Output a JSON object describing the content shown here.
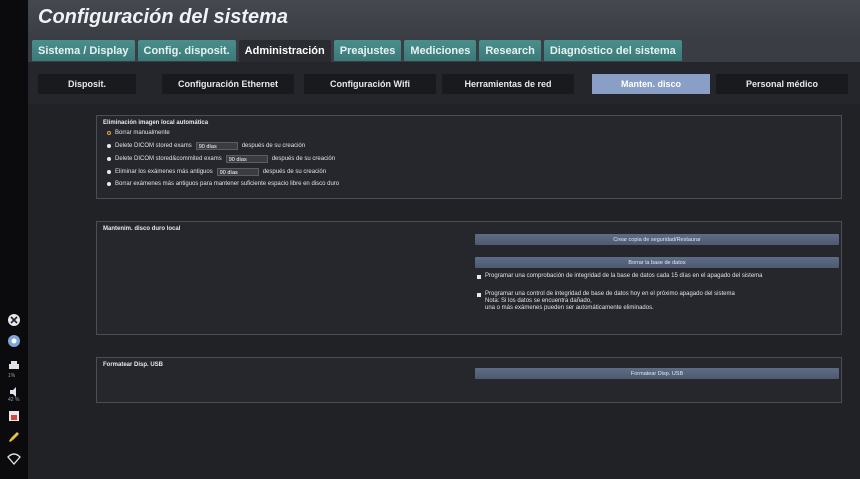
{
  "header": {
    "title": "Configuración del sistema"
  },
  "tabs": [
    {
      "label": "Sistema / Display",
      "active": false
    },
    {
      "label": "Config. disposit.",
      "active": false
    },
    {
      "label": "Administración",
      "active": true
    },
    {
      "label": "Preajustes",
      "active": false
    },
    {
      "label": "Mediciones",
      "active": false
    },
    {
      "label": "Research",
      "active": false
    },
    {
      "label": "Diagnóstico del sistema",
      "active": false
    }
  ],
  "subtabs": [
    {
      "label": "Disposit.",
      "active": false
    },
    {
      "label": "Configuración Ethernet",
      "active": false
    },
    {
      "label": "Configuración Wifi",
      "active": false
    },
    {
      "label": "Herramientas de red",
      "active": false
    },
    {
      "label": "Manten. disco",
      "active": true
    },
    {
      "label": "Personal médico",
      "active": false
    }
  ],
  "auto_delete": {
    "title": "Eliminación imagen local automática",
    "manual": "Borrar manualmente",
    "dicom_stored_label": "Delete DICOM stored exams",
    "dicom_stored_value": "90 días",
    "dicom_committed_label": "Delete DICOM stored&commited exams",
    "dicom_committed_value": "90 días",
    "oldest_label": "Eliminar los exámenes más antiguos",
    "oldest_value": "90 días",
    "after_creation": "después de su creación",
    "free_space": "Borrar exámenes más antiguos para mantener suficiente espacio libre en disco duro"
  },
  "local_disk": {
    "title": "Mantenim. disco duro local",
    "backup_button": "Crear copia de seguridad/Restaurar",
    "delete_db_button": "Borrar la base de datos",
    "check_15_days": "Programar una comprobación de integridad de la base de datos cada 15 días en el apagado del sistema",
    "check_next": "Programar una control de integridad de base de datos hoy en el próximo apagado del sistema",
    "note_line1": "Nota: Si los datos se encuentra dañado,",
    "note_line2": "una o más exámenes pueden ser automáticamente eliminados."
  },
  "usb": {
    "title": "Formatear Disp. USB",
    "format_button": "Formatear Disp. USB"
  },
  "rail": {
    "percent1": "1%",
    "percent2": "42 %"
  },
  "colors": {
    "tab": "#4a8f8d",
    "active_subtab": "#8a9fc6",
    "button": "#5e6d86",
    "radio_selected": "#e6a640"
  }
}
